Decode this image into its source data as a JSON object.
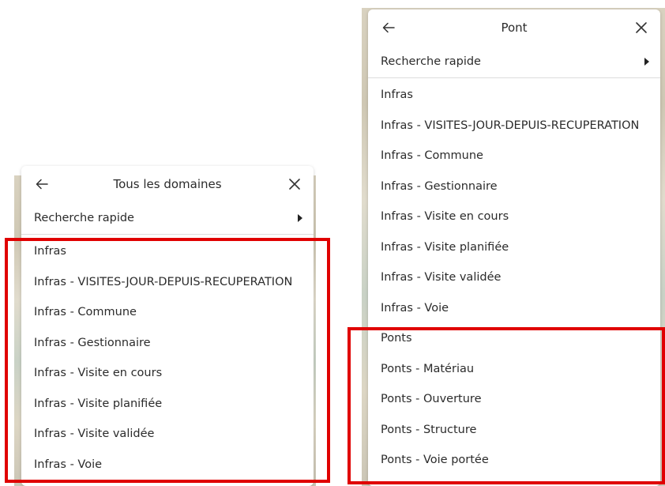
{
  "left_panel": {
    "title": "Tous les domaines",
    "quick_search": "Recherche rapide",
    "items": [
      "Infras",
      "Infras - VISITES-JOUR-DEPUIS-RECUPERATION",
      "Infras - Commune",
      "Infras - Gestionnaire",
      "Infras - Visite en cours",
      "Infras - Visite planifiée",
      "Infras - Visite validée",
      "Infras - Voie"
    ]
  },
  "right_panel": {
    "title": "Pont",
    "quick_search": "Recherche rapide",
    "items": [
      "Infras",
      "Infras - VISITES-JOUR-DEPUIS-RECUPERATION",
      "Infras - Commune",
      "Infras - Gestionnaire",
      "Infras - Visite en cours",
      "Infras - Visite planifiée",
      "Infras - Visite validée",
      "Infras - Voie",
      "Ponts",
      "Ponts - Matériau",
      "Ponts - Ouverture",
      "Ponts - Structure",
      "Ponts - Voie portée"
    ]
  },
  "colors": {
    "highlight": "#e00000",
    "text": "#2b2b2b"
  },
  "icons": [
    "arrow-left-icon",
    "close-icon",
    "caret-right-icon"
  ]
}
